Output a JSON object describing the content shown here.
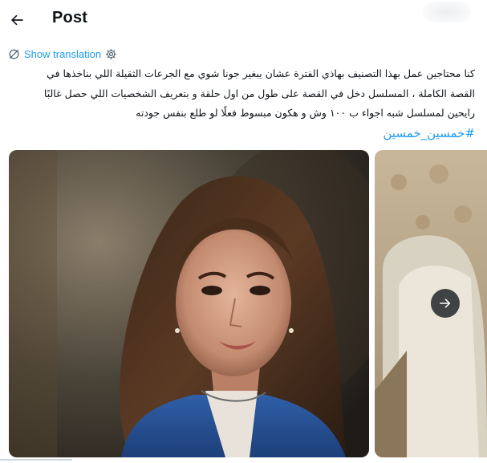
{
  "header": {
    "title": "Post",
    "back_icon": "arrow-left-icon"
  },
  "translation": {
    "label": "Show translation",
    "icon": "translate-slash-icon",
    "settings_icon": "gear-icon"
  },
  "post": {
    "lines": [
      "كنا محتاجين عمل بهذا التصنيف بهاذي الفترة عشان يبغير جونا شوي مع الجرعات الثقيلة اللي بناخذها في",
      "القصة الكاملة ، المسلسل دخل في القصة على طول من اول حلقة و بتعريف الشخصيات اللي حصل غالبًا",
      "رايحين لمسلسل شبه اجواء ب ١٠٠ وش و هكون مبسوط فعلًا لو طلع بنفس جودته"
    ],
    "hashtag": "#خمسين_خمسين"
  },
  "media": {
    "next_icon": "arrow-right-icon",
    "accent": "#1d9bf0"
  }
}
